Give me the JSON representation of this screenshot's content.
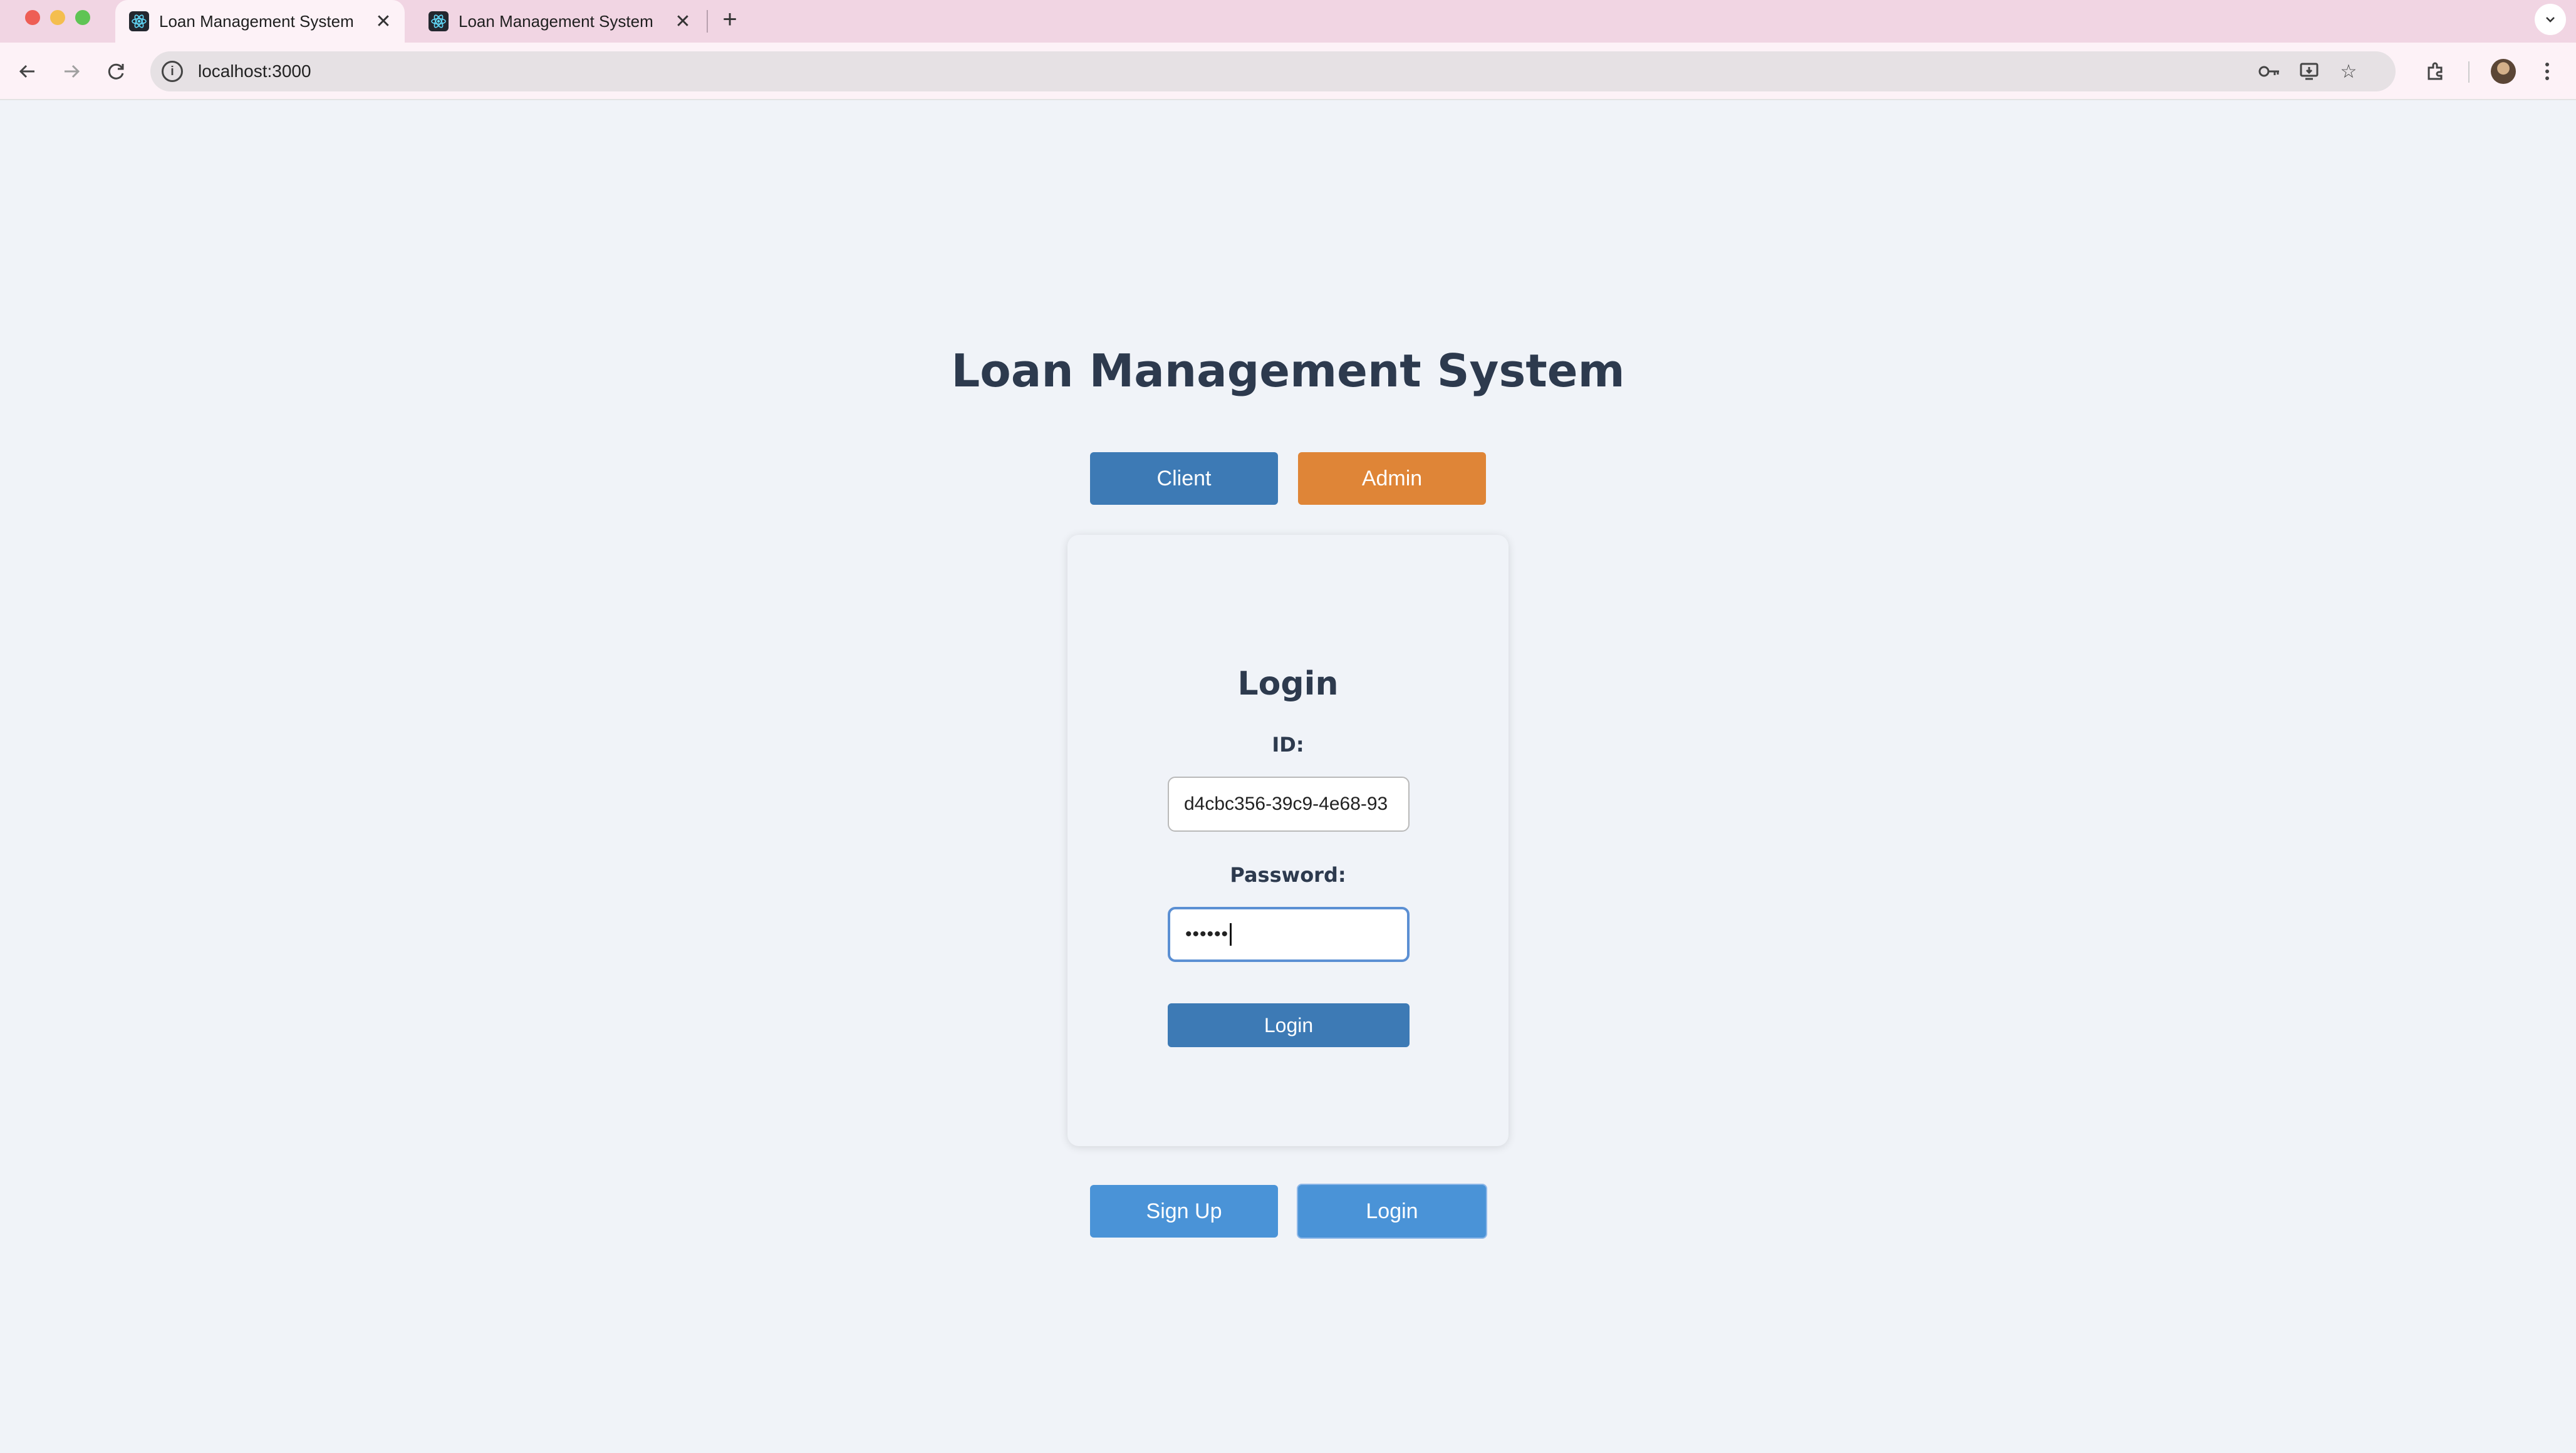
{
  "browser": {
    "tabs": [
      {
        "title": "Loan Management System",
        "active": true
      },
      {
        "title": "Loan Management System",
        "active": false
      }
    ],
    "url": "localhost:3000"
  },
  "app": {
    "title": "Loan Management System",
    "roles": {
      "client_label": "Client",
      "admin_label": "Admin"
    },
    "form": {
      "title": "Login",
      "id_label": "ID:",
      "id_value": "d4cbc356-39c9-4e68-93",
      "password_label": "Password:",
      "password_mask": "••••••",
      "submit_label": "Login"
    },
    "footer": {
      "signup_label": "Sign Up",
      "login_label": "Login"
    }
  },
  "colors": {
    "client_button": "#3d7ab5",
    "admin_button": "#df8537",
    "footer_button": "#4a93d7",
    "heading": "#2d3a4e",
    "page_background": "#f0f3f8"
  }
}
